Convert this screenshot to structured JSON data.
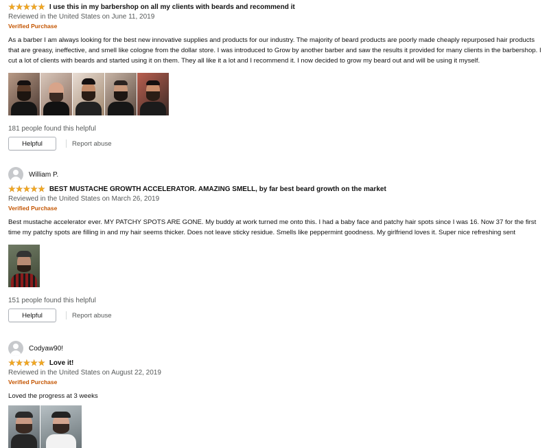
{
  "reviews": [
    {
      "username": "",
      "rating": 5,
      "title": "I use this in my barbershop on all my clients with beards and recommend it",
      "date": "Reviewed in the United States on June 11, 2019",
      "verified": "Verified Purchase",
      "body": "As a barber I am always looking for the best new innovative supplies and products for our industry. The majority of beard products are poorly made cheaply repurposed hair products that are greasy, ineffective, and smell like cologne from the dollar store. I was introduced to Grow by another barber and saw the results it provided for many clients in the barbershop. I cut a lot of clients with beards and started using it on them. They all like it a lot and I recommend it. I now decided to grow my beard out and will be using it myself.",
      "helpful_count": "181 people found this helpful",
      "helpful_label": "Helpful",
      "report_label": "Report abuse",
      "image_count": 5
    },
    {
      "username": "William P.",
      "rating": 5,
      "title": "BEST MUSTACHE GROWTH ACCELERATOR. AMAZING SMELL, by far best beard growth on the market",
      "date": "Reviewed in the United States on March 26, 2019",
      "verified": "Verified Purchase",
      "body": "Best mustache accelerator ever. MY PATCHY SPOTS ARE GONE. My buddy at work turned me onto this. I had a baby face and patchy hair spots since I was 16. Now 37 for the first time my patchy spots are filling in and my hair seems thicker. Does not leave sticky residue. Smells like peppermint goodness. My girlfriend loves it. Super nice refreshing sent",
      "helpful_count": "151 people found this helpful",
      "helpful_label": "Helpful",
      "report_label": "Report abuse",
      "image_count": 1
    },
    {
      "username": "Codyaw90!",
      "rating": 5,
      "title": "Love it!",
      "date": "Reviewed in the United States on August 22, 2019",
      "verified": "Verified Purchase",
      "body": "Loved the progress at 3 weeks",
      "image_count": 2
    }
  ],
  "colors": {
    "star": "#f2a91d",
    "verified": "#c45500",
    "muted": "#565959"
  }
}
